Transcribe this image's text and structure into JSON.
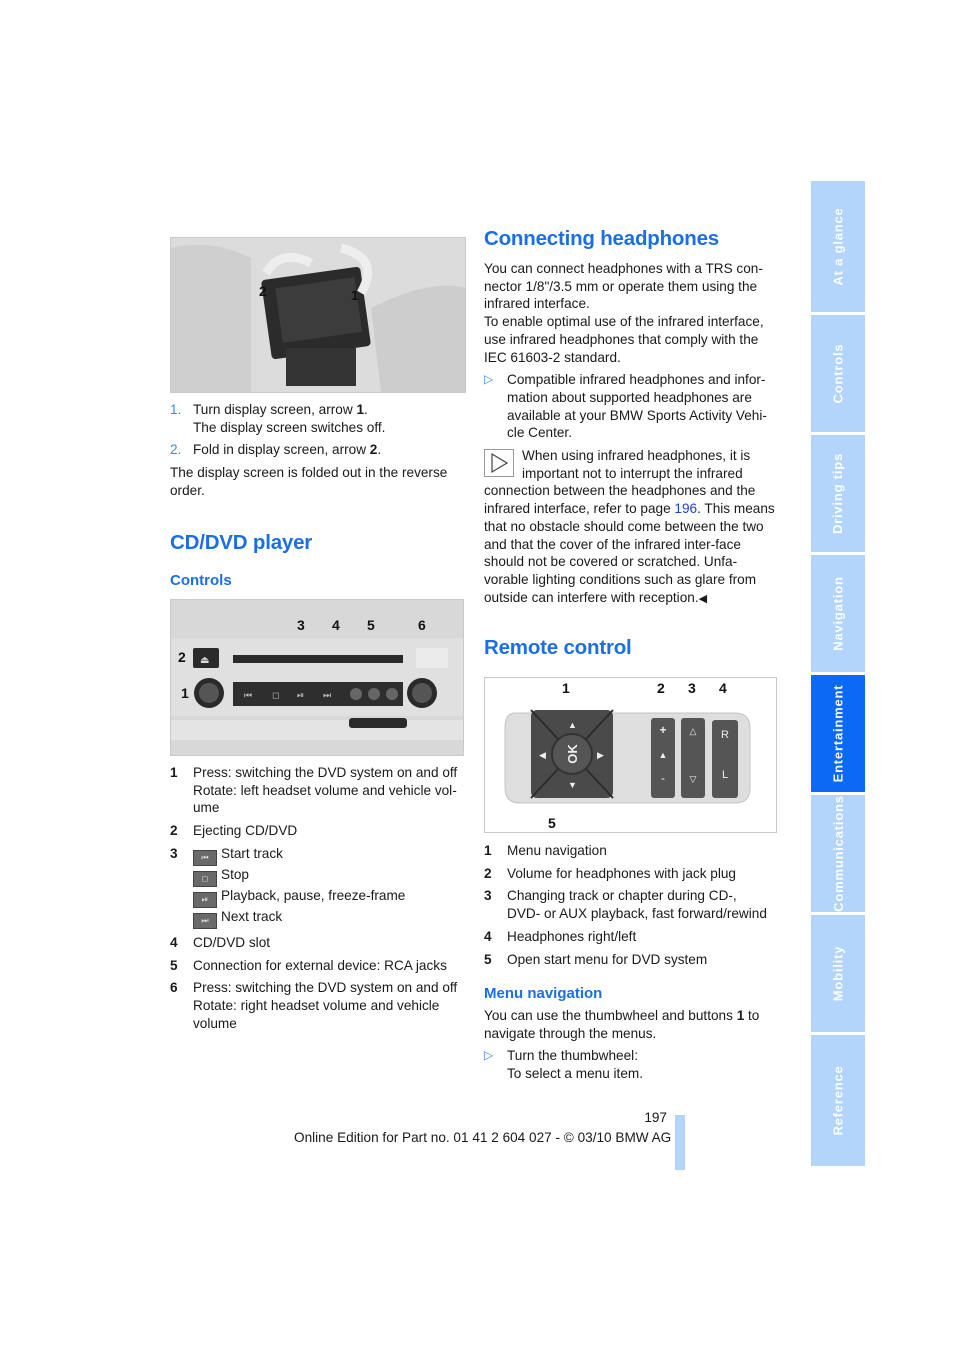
{
  "side_tabs": [
    {
      "label": "At a glance",
      "active": false
    },
    {
      "label": "Controls",
      "active": false
    },
    {
      "label": "Driving tips",
      "active": false
    },
    {
      "label": "Navigation",
      "active": false
    },
    {
      "label": "Entertainment",
      "active": true
    },
    {
      "label": "Communications",
      "active": false
    },
    {
      "label": "Mobility",
      "active": false
    },
    {
      "label": "Reference",
      "active": false
    }
  ],
  "left": {
    "fig1": {
      "callouts": [
        "1",
        "2"
      ]
    },
    "steps": [
      {
        "num": "1.",
        "text": "Turn display screen, arrow ",
        "bold": "1",
        "end": ".",
        "sub": "The display screen switches off."
      },
      {
        "num": "2.",
        "text": "Fold in display screen, arrow ",
        "bold": "2",
        "end": "."
      }
    ],
    "note": "The display screen is folded out in the reverse order.",
    "cd_title": "CD/DVD player",
    "controls_title": "Controls",
    "fig2": {
      "callouts": [
        "1",
        "2",
        "3",
        "4",
        "5",
        "6"
      ]
    },
    "items": [
      {
        "num": "1",
        "lines": [
          "Press: switching the DVD system on and off",
          "Rotate: left headset volume and vehicle vol-",
          "ume"
        ]
      },
      {
        "num": "2",
        "lines": [
          "Ejecting CD/DVD"
        ]
      },
      {
        "num": "3",
        "buttons": [
          {
            "icon": "skip-back-icon",
            "glyph": "⏮",
            "label": "Start track"
          },
          {
            "icon": "stop-icon",
            "glyph": "◻",
            "label": "Stop"
          },
          {
            "icon": "play-pause-icon",
            "glyph": "⏯",
            "label": "Playback, pause, freeze-frame"
          },
          {
            "icon": "skip-forward-icon",
            "glyph": "⏭",
            "label": "Next track"
          }
        ]
      },
      {
        "num": "4",
        "lines": [
          "CD/DVD slot"
        ]
      },
      {
        "num": "5",
        "lines": [
          "Connection for external device: RCA jacks"
        ]
      },
      {
        "num": "6",
        "lines": [
          "Press: switching the DVD system on and off",
          "Rotate: right headset volume and vehicle",
          "volume"
        ]
      }
    ]
  },
  "right": {
    "headphones_title": "Connecting headphones",
    "para1": "You can connect headphones with a TRS con-nector 1/8\"/3.5 mm or operate them using the infrared interface.",
    "para2": "To enable optimal use of the infrared interface, use infrared headphones that comply with the IEC 61603-2 standard.",
    "bullet1": "Compatible infrared headphones and infor-mation about supported headphones are available at your BMW Sports Activity Vehi-cle Center.",
    "note_pre": "When using infrared headphones, it is important not to interrupt the infrared connection between the headphones and the infrared interface, refer to page ",
    "note_link": "196",
    "note_post": ". This means that no obstacle should come between the two and that the cover of the infrared inter-face should not be covered or scratched. Unfa-vorable lighting conditions such as glare from outside can interfere with reception.",
    "note_end": "◀",
    "remote_title": "Remote control",
    "fig3": {
      "callouts": [
        "1",
        "2",
        "3",
        "4",
        "5"
      ],
      "ok_label": "OK"
    },
    "items": [
      {
        "num": "1",
        "lines": [
          "Menu navigation"
        ]
      },
      {
        "num": "2",
        "lines": [
          "Volume for headphones with jack plug"
        ]
      },
      {
        "num": "3",
        "lines": [
          "Changing track or chapter during CD-,",
          "DVD- or AUX playback, fast forward/rewind"
        ]
      },
      {
        "num": "4",
        "lines": [
          "Headphones right/left"
        ]
      },
      {
        "num": "5",
        "lines": [
          "Open start menu for DVD system"
        ]
      }
    ],
    "menu_nav_title": "Menu navigation",
    "menu_nav_text_pre": "You can use the thumbwheel and buttons ",
    "menu_nav_bold": "1",
    "menu_nav_text_post": " to navigate through the menus.",
    "bullet2_lines": [
      "Turn the thumbwheel:",
      "To select a menu item."
    ]
  },
  "footer": {
    "page_number": "197",
    "edition": "Online Edition for Part no. 01 41 2 604 027 - © 03/10 BMW AG"
  },
  "colors": {
    "accent": "#1a6fe8",
    "tab_inactive": "#b3d4fb",
    "tab_active": "#0a6af5"
  }
}
